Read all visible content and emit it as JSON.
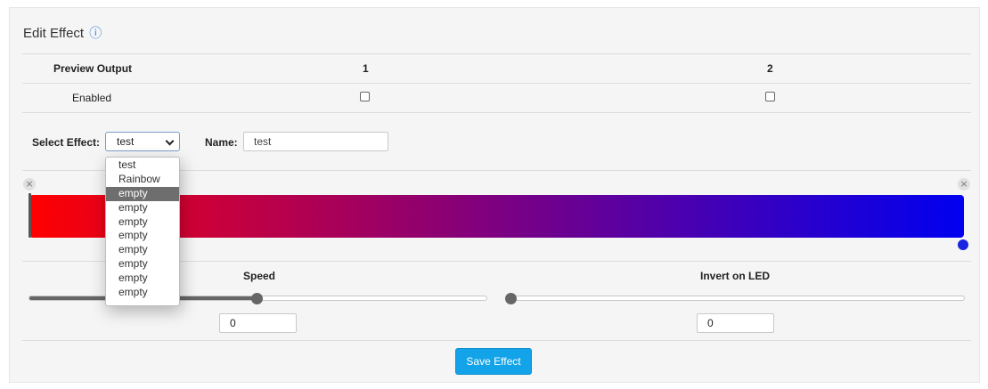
{
  "title": "Edit Effect",
  "info_icon": "ⓘ",
  "table": {
    "header_label": "Preview Output",
    "columns": [
      "1",
      "2"
    ],
    "enabled_label": "Enabled"
  },
  "select_effect": {
    "label": "Select Effect:",
    "value": "test",
    "options": [
      "test",
      "Rainbow",
      "empty",
      "empty",
      "empty",
      "empty",
      "empty",
      "empty",
      "empty",
      "empty"
    ],
    "highlighted_index": 2
  },
  "name_field": {
    "label": "Name:",
    "value": "test"
  },
  "gradient": {
    "colors": [
      "#ff0000",
      "#c8003c",
      "#8a0075",
      "#4a00b0",
      "#0000f0"
    ],
    "remove_icon": "×"
  },
  "speed": {
    "label": "Speed",
    "slider_fraction": 0.52,
    "value": "0"
  },
  "invert": {
    "label": "Invert on LED",
    "slider_fraction": 0.0,
    "value": "0"
  },
  "save_label": "Save Effect",
  "colors": {
    "accent": "#13a3e8",
    "info": "#2f7fd8"
  }
}
